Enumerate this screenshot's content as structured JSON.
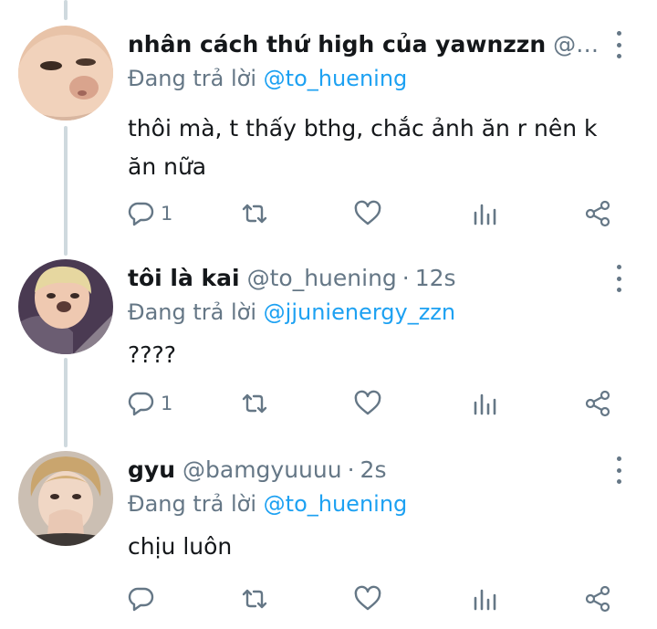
{
  "colors": {
    "text": "#14171a",
    "muted": "#657786",
    "accent": "#1da1f2",
    "thread_line": "#cfd9de"
  },
  "tweets": [
    {
      "name": "nhân cách thứ high của yawnzzn",
      "handle": "@jju...",
      "time": "",
      "replying_label": "Đang trả lời",
      "replying_to": "@to_huening",
      "text": "thôi mà, t thấy bthg, chắc ảnh ăn r nên k ăn nữa",
      "reply_count": "1",
      "icons": [
        "reply-icon",
        "retweet-icon",
        "like-icon",
        "stats-icon",
        "share-icon",
        "more-icon"
      ]
    },
    {
      "name": "tôi là kai",
      "handle": "@to_huening",
      "time": "12s",
      "replying_label": "Đang trả lời",
      "replying_to": "@jjunienergy_zzn",
      "text": "????",
      "reply_count": "1",
      "icons": [
        "reply-icon",
        "retweet-icon",
        "like-icon",
        "stats-icon",
        "share-icon",
        "more-icon"
      ]
    },
    {
      "name": "gyu",
      "handle": "@bamgyuuuu",
      "time": "2s",
      "replying_label": "Đang trả lời",
      "replying_to": "@to_huening",
      "text": "chịu luôn",
      "reply_count": "",
      "icons": [
        "reply-icon",
        "retweet-icon",
        "like-icon",
        "stats-icon",
        "share-icon",
        "more-icon"
      ]
    }
  ]
}
